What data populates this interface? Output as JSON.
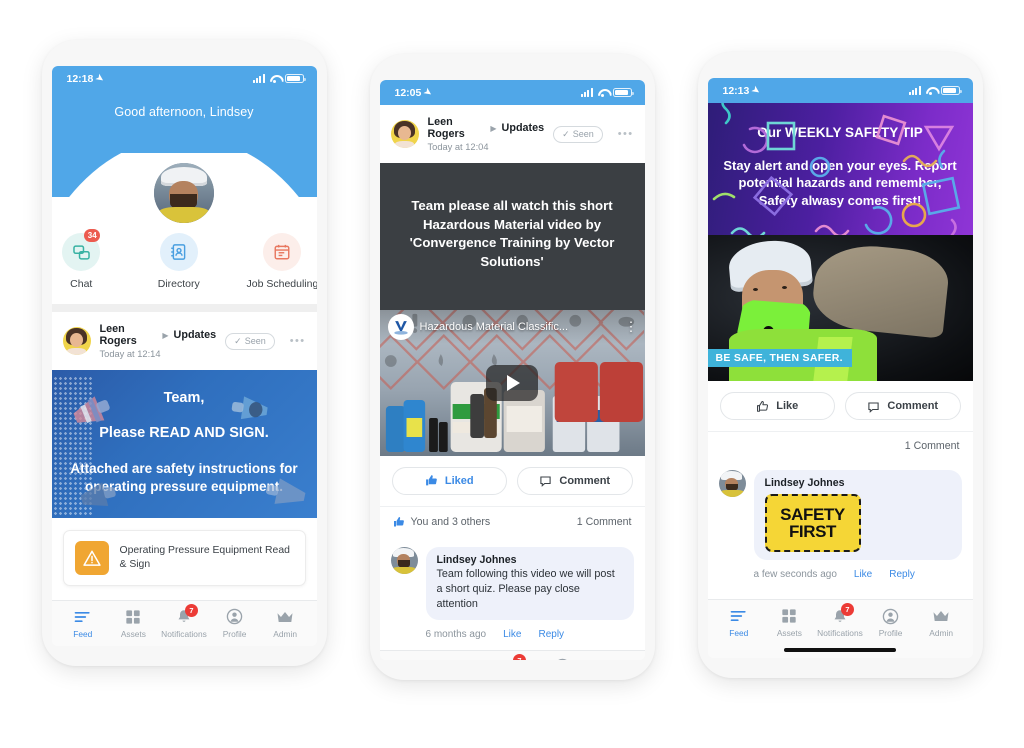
{
  "phones": [
    {
      "id": "phone-home-feed",
      "status_bar": {
        "time": "12:18",
        "location_icon": "location-arrow-icon",
        "signal_icon": "signal-bars-icon",
        "wifi_icon": "wifi-icon",
        "battery_icon": "battery-icon"
      },
      "greeting": "Good afternoon, Lindsey",
      "quick_actions": [
        {
          "label": "Chat",
          "icon": "chat-bubbles-icon",
          "badge": "34",
          "color": "#38b2a3"
        },
        {
          "label": "Directory",
          "icon": "address-book-icon",
          "badge": "",
          "color": "#4a9fe0"
        },
        {
          "label": "Job Scheduling",
          "icon": "calendar-icon",
          "badge": "",
          "color": "#e8775f"
        }
      ],
      "post": {
        "author": "Leen Rogers",
        "channel": "Updates",
        "timestamp": "Today at 12:14",
        "seen_label": "Seen",
        "more_label": "•••",
        "graphic": {
          "line1": "Team,",
          "line2": "Please READ AND SIGN.",
          "line3": "Attached are safety instructions for operating pressure equipment."
        },
        "attachment": {
          "title": "Operating Pressure Equipment Read & Sign",
          "icon": "warning-triangle-icon"
        }
      }
    },
    {
      "id": "phone-video-post",
      "status_bar": {
        "time": "12:05"
      },
      "post": {
        "author": "Leen Rogers",
        "channel": "Updates",
        "timestamp": "Today at 12:04",
        "seen_label": "Seen",
        "more_label": "•••",
        "text_card": "Team please all watch this short Hazardous Material video by 'Convergence Training by Vector Solutions'",
        "video": {
          "title": "Hazardous Material Classific...",
          "play_icon": "play-button-icon",
          "menu_icon": "kebab-menu-icon",
          "logo": "vector-solutions-logo"
        },
        "actions": {
          "like_label": "Liked",
          "like_icon": "thumbs-up-filled-icon",
          "comment_label": "Comment",
          "comment_icon": "speech-bubble-icon"
        },
        "reactions_text": "You and 3 others",
        "comment_count": "1 Comment",
        "comments": [
          {
            "author": "Lindsey Johnes",
            "text": "Team following this video we will post a short quiz. Please pay close attention",
            "ago": "6 months ago",
            "like_label": "Like",
            "reply_label": "Reply"
          }
        ]
      }
    },
    {
      "id": "phone-safety-tip-post",
      "status_bar": {
        "time": "12:13"
      },
      "post": {
        "banner": {
          "heading": "Our WEEKLY SAFETY TIP",
          "body": "Stay alert and open your eyes. Report potential hazards and remember, Safety alwasy comes first!"
        },
        "photo_caption": "BE SAFE, THEN SAFER.",
        "actions": {
          "like_label": "Like",
          "like_icon": "thumbs-up-outline-icon",
          "comment_label": "Comment",
          "comment_icon": "speech-bubble-icon"
        },
        "comment_count": "1 Comment",
        "comments": [
          {
            "author": "Lindsey Johnes",
            "sticker_line1": "SAFETY",
            "sticker_line2": "FIRST",
            "ago": "a few seconds ago",
            "like_label": "Like",
            "reply_label": "Reply"
          }
        ]
      }
    }
  ],
  "bottom_nav": {
    "items": [
      {
        "label": "Feed",
        "icon": "feed-lines-icon",
        "active": true,
        "badge": ""
      },
      {
        "label": "Assets",
        "icon": "grid-squares-icon",
        "active": false,
        "badge": ""
      },
      {
        "label": "Notifications",
        "icon": "bell-icon",
        "active": false,
        "badge": "7"
      },
      {
        "label": "Profile",
        "icon": "person-circle-icon",
        "active": false,
        "badge": ""
      },
      {
        "label": "Admin",
        "icon": "crown-icon",
        "active": false,
        "badge": ""
      }
    ],
    "active_color": "#3b8ae5",
    "inactive_color": "#9aa3ab",
    "badge_color": "#ec3b36"
  }
}
